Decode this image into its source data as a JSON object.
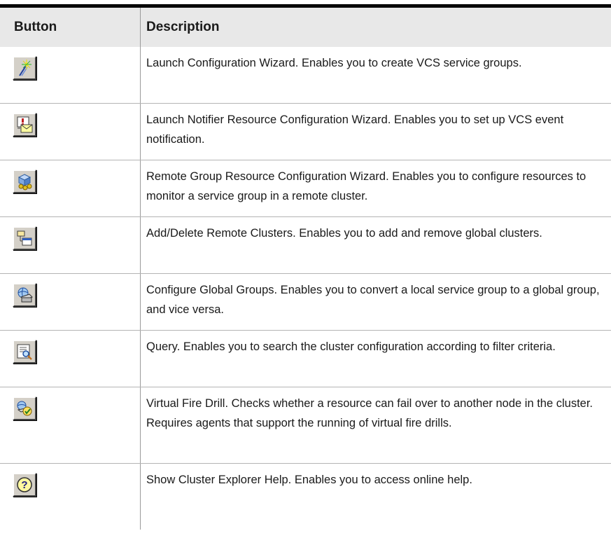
{
  "table": {
    "headers": {
      "button": "Button",
      "description": "Description"
    },
    "rows": [
      {
        "icon": "configuration-wizard-icon",
        "description": "Launch Configuration Wizard. Enables you to create VCS service groups."
      },
      {
        "icon": "notifier-wizard-icon",
        "description": "Launch Notifier Resource Configuration Wizard. Enables you to set up VCS event notification."
      },
      {
        "icon": "remote-group-wizard-icon",
        "description": "Remote Group Resource Configuration Wizard. Enables you to configure resources to monitor a service group in a remote cluster."
      },
      {
        "icon": "remote-clusters-icon",
        "description": "Add/Delete Remote Clusters. Enables you to add and remove global clusters."
      },
      {
        "icon": "global-groups-icon",
        "description": "Configure Global Groups. Enables you to convert a local service group to a global group, and vice versa."
      },
      {
        "icon": "query-icon",
        "description": "Query. Enables you to search the cluster configuration according to filter criteria."
      },
      {
        "icon": "virtual-fire-drill-icon",
        "description": "Virtual Fire Drill. Checks whether a resource can fail over to another node in the cluster. Requires agents that support the running of virtual fire drills."
      },
      {
        "icon": "help-icon",
        "description": "Show Cluster Explorer Help. Enables you to access online help."
      }
    ]
  }
}
